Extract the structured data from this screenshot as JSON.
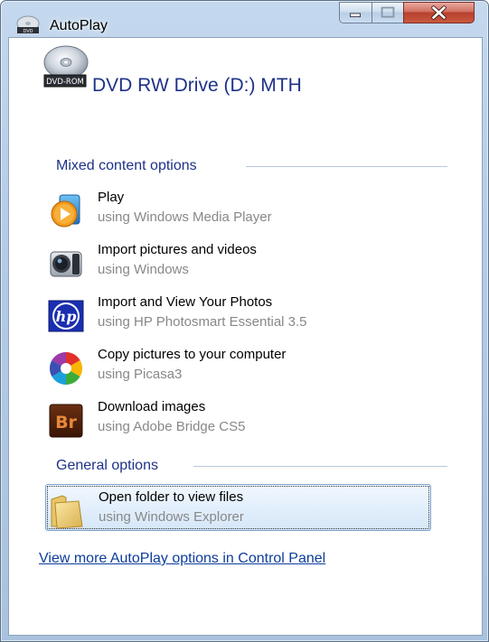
{
  "window": {
    "title": "AutoPlay",
    "minimize_icon": "minimize-icon",
    "maximize_icon": "maximize-icon",
    "close_icon": "close-icon"
  },
  "drive": {
    "title": "DVD RW Drive (D:) MTH",
    "icon": "dvd-rom-disc-icon",
    "badge": "DVD-ROM"
  },
  "sections": {
    "mixed": "Mixed content options",
    "general": "General options"
  },
  "mixed_items": [
    {
      "label": "Play",
      "sub": "using Windows Media Player",
      "icon": "media-player-icon"
    },
    {
      "label": "Import pictures and videos",
      "sub": "using Windows",
      "icon": "camera-icon"
    },
    {
      "label": "Import and View Your Photos",
      "sub": "using HP Photosmart Essential 3.5",
      "icon": "hp-logo-icon",
      "icon_text": "hp"
    },
    {
      "label": "Copy pictures to your computer",
      "sub": "using Picasa3",
      "icon": "picasa-icon"
    },
    {
      "label": "Download images",
      "sub": "using Adobe Bridge CS5",
      "icon": "adobe-bridge-icon",
      "icon_text": "Br"
    }
  ],
  "general_items": [
    {
      "label": "Open folder to view files",
      "sub": "using Windows Explorer",
      "icon": "folder-icon",
      "selected": true
    }
  ],
  "footer_link": "View more AutoPlay options in Control Panel",
  "colors": {
    "heading_blue": "#1e3287",
    "link_blue": "#0d3d9c",
    "subtext_gray": "#888888",
    "selection_border": "#7da2ce",
    "close_red": "#c9593f"
  }
}
